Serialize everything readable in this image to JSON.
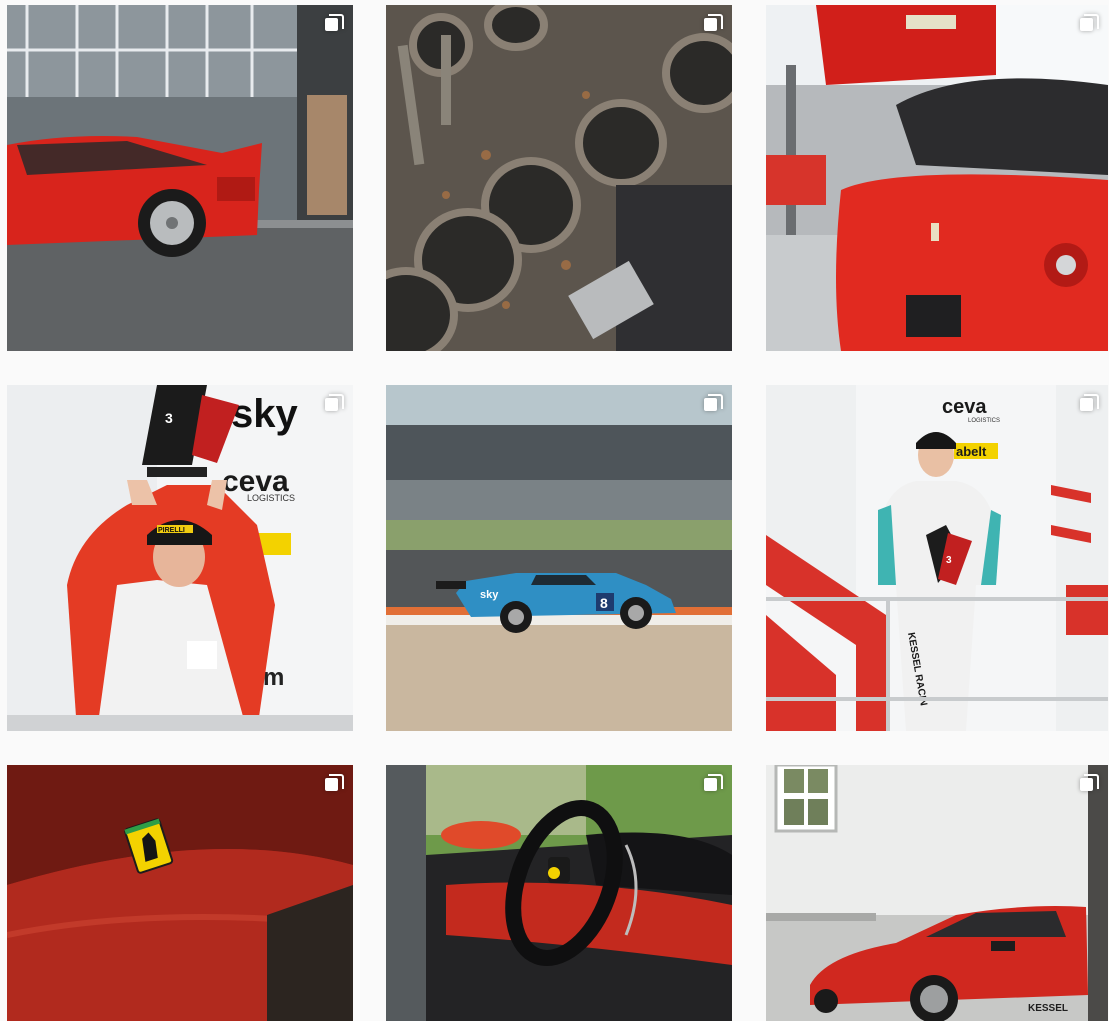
{
  "grid": {
    "posts": [
      {
        "id": 1,
        "subject": "red-f40-side"
      },
      {
        "id": 2,
        "subject": "engine-block"
      },
      {
        "id": 3,
        "subject": "workshop-red-ferrari"
      },
      {
        "id": 4,
        "subject": "driver-trophy-podium",
        "trophy_number": "3",
        "banner_sky": "sky",
        "banner_ceva": "ceva",
        "banner_logistics": "LOGISTICS",
        "banner_pirelli": "PIRELLI",
        "banner_form": "orm"
      },
      {
        "id": 5,
        "subject": "blue-race-car-track",
        "car_number": "8",
        "car_sponsor": "sky"
      },
      {
        "id": 6,
        "subject": "driver-kessel-podium",
        "banner_ceva": "ceva",
        "banner_logistics": "LOGISTICS",
        "banner_abelt": "abelt",
        "trophy_number": "3",
        "suit_text": "KESSEL RACIN"
      },
      {
        "id": 7,
        "subject": "ferrari-hood-badge"
      },
      {
        "id": 8,
        "subject": "ferrari-interior-steering"
      },
      {
        "id": 9,
        "subject": "red-ferrari-white-building",
        "plate_text": "KESSEL"
      }
    ],
    "multi_icon": "carousel-icon",
    "background_color": "#fafafa"
  }
}
